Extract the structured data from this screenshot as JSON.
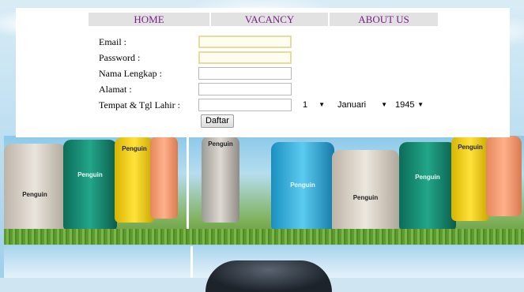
{
  "nav": {
    "items": [
      {
        "label": "HOME"
      },
      {
        "label": "VACANCY"
      },
      {
        "label": "ABOUT US"
      }
    ]
  },
  "form": {
    "email_label": "Email :",
    "password_label": "Password :",
    "nama_label": "Nama Lengkap :",
    "alamat_label": "Alamat :",
    "ttl_label": "Tempat & Tgl Lahir :",
    "email_value": "",
    "password_value": "",
    "nama_value": "",
    "alamat_value": "",
    "tempat_value": "",
    "day_selected": "1",
    "month_selected": "Januari",
    "year_selected": "1945",
    "submit_label": "Daftar"
  },
  "banner": {
    "brand": "Penguin"
  },
  "colors": {
    "nav_text": "#7b1f86",
    "nav_bg": "#e2e2e2",
    "focus_border": "#e7dca0"
  }
}
